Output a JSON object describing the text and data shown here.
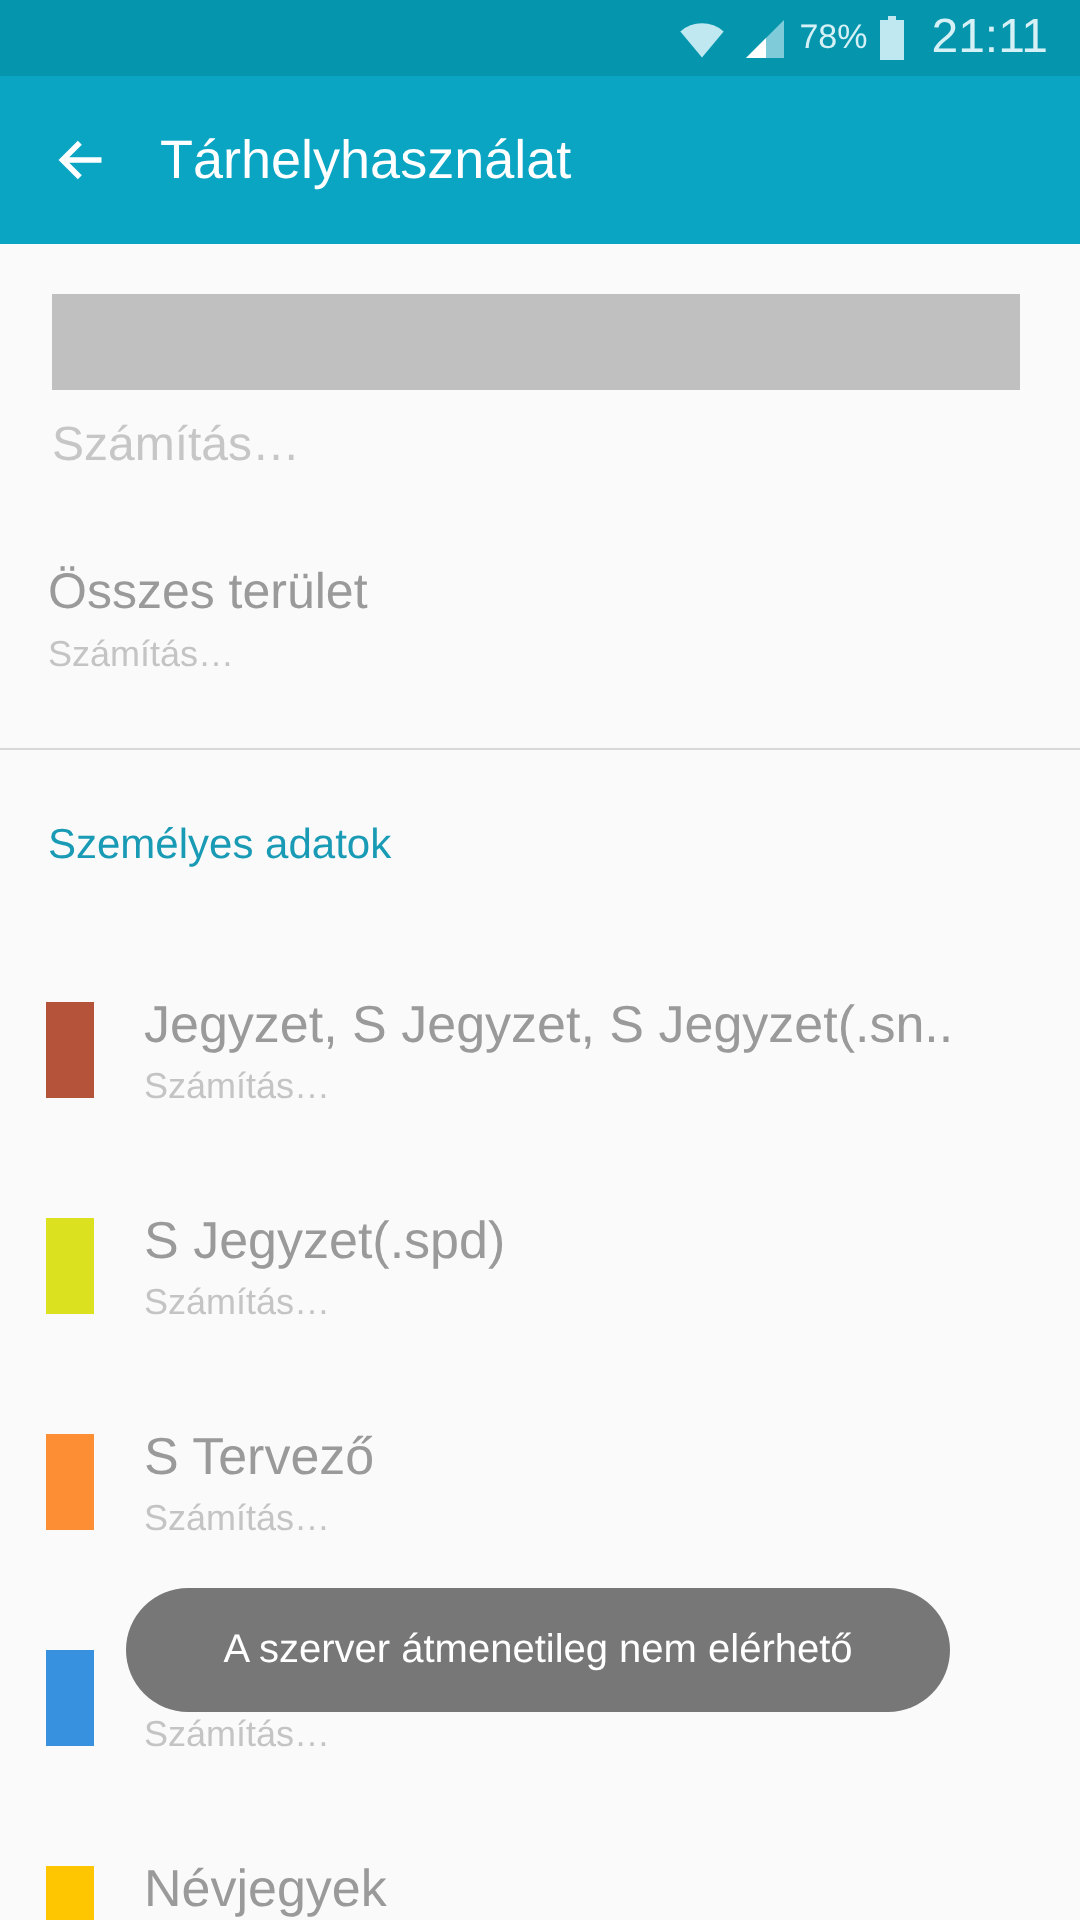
{
  "status_bar": {
    "battery": "78%",
    "time": "21:11"
  },
  "app_bar": {
    "title": "Tárhelyhasználat"
  },
  "summary": {
    "status": "Számítás…"
  },
  "total": {
    "title": "Összes terület",
    "status": "Számítás…"
  },
  "section": {
    "title": "Személyes adatok"
  },
  "items": [
    {
      "title": "Jegyzet, S Jegyzet, S Jegyzet(.sn..",
      "status": "Számítás…",
      "color": "#b5533a"
    },
    {
      "title": "S Jegyzet(.spd)",
      "status": "Számítás…",
      "color": "#dbe01f"
    },
    {
      "title": "S Tervező",
      "status": "Számítás…",
      "color": "#fd8e34"
    },
    {
      "status": "Számítás…",
      "color": "#3791de"
    },
    {
      "title": "Névjegyek",
      "color": "#fdc600"
    }
  ],
  "toast": {
    "text": "A szerver átmenetileg nem elérhető"
  }
}
